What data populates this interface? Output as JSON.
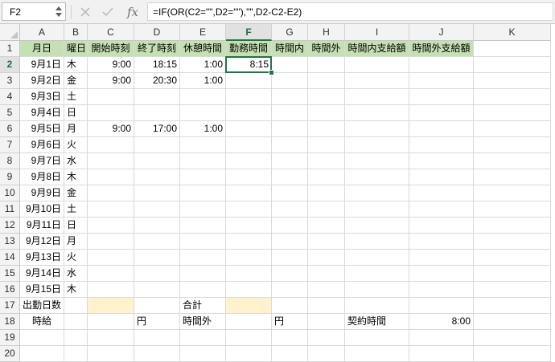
{
  "formula_bar": {
    "name_box": "F2",
    "formula": "=IF(OR(C2=\"\",D2=\"\"),\"\",D2-C2-E2)",
    "fx_label": "fx"
  },
  "icons": {
    "cancel": "cancel-x-icon",
    "enter": "enter-check-icon",
    "function": "insert-function-icon",
    "name_box_spinner": "up-down-arrows-icon"
  },
  "colors": {
    "header_green": "#c5e0b3",
    "input_yellow": "#fff2cc",
    "selection": "#217346"
  },
  "columns": [
    "A",
    "B",
    "C",
    "D",
    "E",
    "F",
    "G",
    "H",
    "I",
    "J",
    "K"
  ],
  "selected": {
    "column": "F",
    "row": "2"
  },
  "rows": [
    {
      "num": "1",
      "cells": [
        "月日",
        "曜日",
        "開始時刻",
        "終了時刻",
        "休憩時間",
        "勤務時間",
        "時間内",
        "時間外",
        "時間内支給額",
        "時間外支給額",
        ""
      ]
    },
    {
      "num": "2",
      "cells": [
        "9月1日",
        "木",
        "9:00",
        "18:15",
        "1:00",
        "8:15",
        "",
        "",
        "",
        "",
        ""
      ]
    },
    {
      "num": "3",
      "cells": [
        "9月2日",
        "金",
        "9:00",
        "20:30",
        "1:00",
        "",
        "",
        "",
        "",
        "",
        ""
      ]
    },
    {
      "num": "4",
      "cells": [
        "9月3日",
        "土",
        "",
        "",
        "",
        "",
        "",
        "",
        "",
        "",
        ""
      ]
    },
    {
      "num": "5",
      "cells": [
        "9月4日",
        "日",
        "",
        "",
        "",
        "",
        "",
        "",
        "",
        "",
        ""
      ]
    },
    {
      "num": "6",
      "cells": [
        "9月5日",
        "月",
        "9:00",
        "17:00",
        "1:00",
        "",
        "",
        "",
        "",
        "",
        ""
      ]
    },
    {
      "num": "7",
      "cells": [
        "9月6日",
        "火",
        "",
        "",
        "",
        "",
        "",
        "",
        "",
        "",
        ""
      ]
    },
    {
      "num": "8",
      "cells": [
        "9月7日",
        "水",
        "",
        "",
        "",
        "",
        "",
        "",
        "",
        "",
        ""
      ]
    },
    {
      "num": "9",
      "cells": [
        "9月8日",
        "木",
        "",
        "",
        "",
        "",
        "",
        "",
        "",
        "",
        ""
      ]
    },
    {
      "num": "10",
      "cells": [
        "9月9日",
        "金",
        "",
        "",
        "",
        "",
        "",
        "",
        "",
        "",
        ""
      ]
    },
    {
      "num": "11",
      "cells": [
        "9月10日",
        "土",
        "",
        "",
        "",
        "",
        "",
        "",
        "",
        "",
        ""
      ]
    },
    {
      "num": "12",
      "cells": [
        "9月11日",
        "日",
        "",
        "",
        "",
        "",
        "",
        "",
        "",
        "",
        ""
      ]
    },
    {
      "num": "13",
      "cells": [
        "9月12日",
        "月",
        "",
        "",
        "",
        "",
        "",
        "",
        "",
        "",
        ""
      ]
    },
    {
      "num": "14",
      "cells": [
        "9月13日",
        "火",
        "",
        "",
        "",
        "",
        "",
        "",
        "",
        "",
        ""
      ]
    },
    {
      "num": "15",
      "cells": [
        "9月14日",
        "水",
        "",
        "",
        "",
        "",
        "",
        "",
        "",
        "",
        ""
      ]
    },
    {
      "num": "16",
      "cells": [
        "9月15日",
        "木",
        "",
        "",
        "",
        "",
        "",
        "",
        "",
        "",
        ""
      ]
    },
    {
      "num": "17",
      "cells": [
        "出勤日数",
        "",
        "",
        "",
        "合計",
        "",
        "",
        "",
        "",
        "",
        ""
      ]
    },
    {
      "num": "18",
      "cells": [
        "時給",
        "",
        "",
        "円",
        "時間外",
        "",
        "円",
        "",
        "契約時間",
        "8:00",
        ""
      ]
    },
    {
      "num": "19",
      "cells": [
        "",
        "",
        "",
        "",
        "",
        "",
        "",
        "",
        "",
        "",
        ""
      ]
    },
    {
      "num": "20",
      "cells": [
        "",
        "",
        "",
        "",
        "",
        "",
        "",
        "",
        "",
        "",
        ""
      ]
    }
  ]
}
